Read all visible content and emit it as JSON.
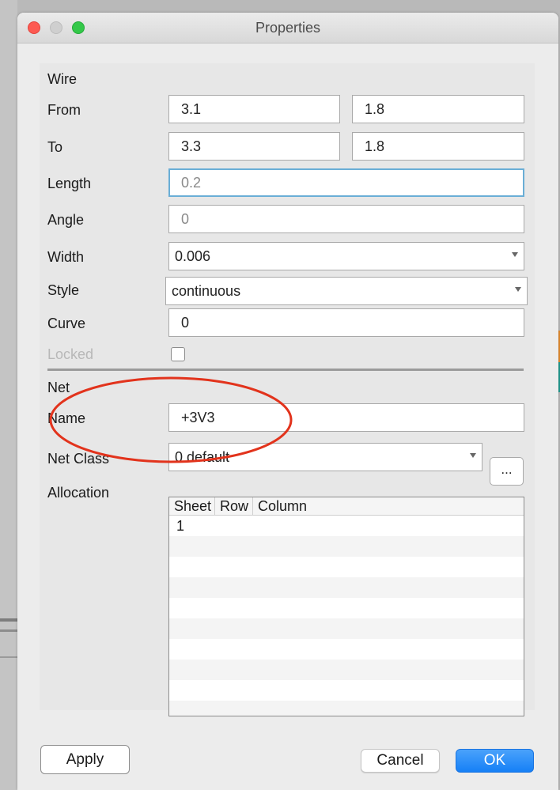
{
  "window": {
    "title": "Properties"
  },
  "wire": {
    "section_label": "Wire",
    "from": {
      "label": "From",
      "x": "3.1",
      "y": "1.8"
    },
    "to": {
      "label": "To",
      "x": "3.3",
      "y": "1.8"
    },
    "length": {
      "label": "Length",
      "value": "0.2"
    },
    "angle": {
      "label": "Angle",
      "value": "0"
    },
    "width": {
      "label": "Width",
      "value": "0.006"
    },
    "style": {
      "label": "Style",
      "value": "continuous"
    },
    "curve": {
      "label": "Curve",
      "value": "0"
    },
    "locked": {
      "label": "Locked",
      "checked": false
    }
  },
  "net": {
    "section_label": "Net",
    "name": {
      "label": "Name",
      "value": "+3V3"
    },
    "net_class": {
      "label": "Net Class",
      "value": "0 default",
      "more_label": "..."
    },
    "allocation": {
      "label": "Allocation",
      "columns": [
        "Sheet",
        "Row",
        "Column"
      ],
      "rows": [
        {
          "sheet": "1",
          "row": "",
          "column": ""
        }
      ]
    }
  },
  "buttons": {
    "apply": "Apply",
    "cancel": "Cancel",
    "ok": "OK"
  },
  "colors": {
    "annotation_circle": "#e2331c",
    "accent": "#1680f6",
    "focus_ring": "#6aaed6"
  }
}
